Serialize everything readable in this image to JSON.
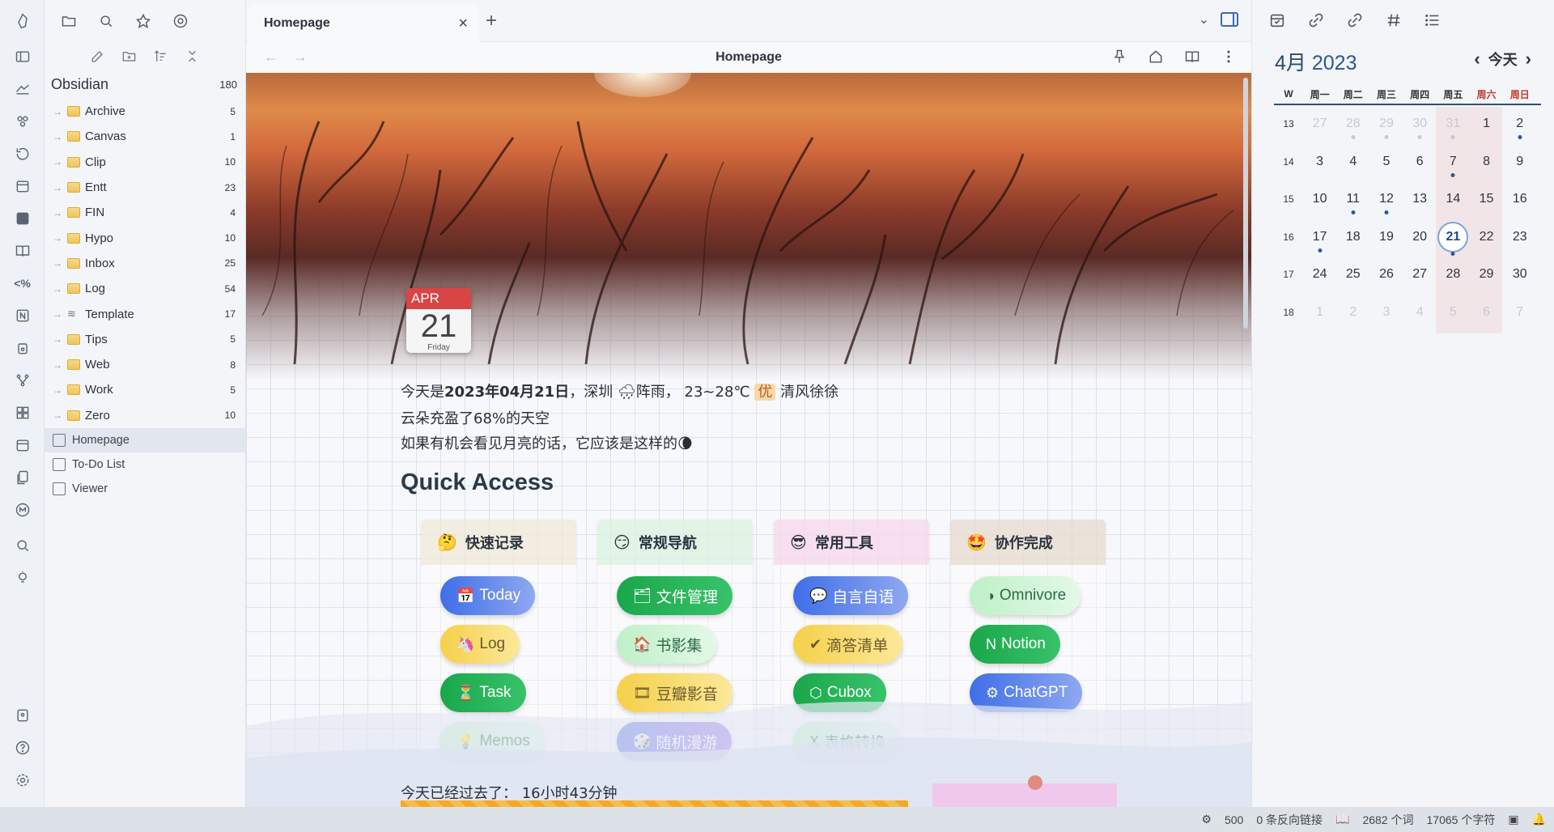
{
  "ribbon": {
    "icons": [
      "obsidian-logo-icon",
      "layout-icon",
      "flashcards-icon",
      "graph-icon",
      "history-icon",
      "calendar-icon",
      "hub-icon",
      "book-icon",
      "template-icon",
      "notion-icon",
      "copy-icon",
      "git-icon",
      "grid-icon",
      "calendar-icon-2",
      "files-icon",
      "medium-icon",
      "search-icon",
      "bulb-icon",
      "vault-icon",
      "help-icon",
      "settings-icon"
    ]
  },
  "sidebar": {
    "vault_name": "Obsidian",
    "vault_count": "180",
    "folders": [
      {
        "label": "Archive",
        "count": "5"
      },
      {
        "label": "Canvas",
        "count": "1"
      },
      {
        "label": "Clip",
        "count": "10"
      },
      {
        "label": "Entt",
        "count": "23"
      },
      {
        "label": "FIN",
        "count": "4"
      },
      {
        "label": "Hypo",
        "count": "10"
      },
      {
        "label": "Inbox",
        "count": "25"
      },
      {
        "label": "Log",
        "count": "54"
      },
      {
        "label": "Template",
        "count": "17"
      },
      {
        "label": "Tips",
        "count": "5"
      },
      {
        "label": "Web",
        "count": "8"
      },
      {
        "label": "Work",
        "count": "5"
      },
      {
        "label": "Zero",
        "count": "10"
      }
    ],
    "notes": [
      "Homepage",
      "To-Do List",
      "Viewer"
    ]
  },
  "tab": {
    "label": "Homepage"
  },
  "view": {
    "title": "Homepage"
  },
  "calendar_icon": {
    "month": "APR",
    "day": "21",
    "weekday": "Friday"
  },
  "weather": {
    "line1_pre": "今天是",
    "line1_date": "2023年04月21日",
    "line1_city": "，深圳 ",
    "line1_icon": "🌧",
    "line1_weather": "阵雨，  23~28℃ ",
    "line1_aqi": "优",
    "line1_wind": " 清风徐徐",
    "line2": "云朵充盈了68%的天空",
    "line3": "如果有机会看见月亮的话，它应该是这样的",
    "moon": "🌘"
  },
  "quick_access": {
    "title": "Quick Access"
  },
  "cards": [
    {
      "title": "快速记录",
      "emoji": "🤔",
      "bg": "rgba(235,225,200,.55)",
      "pills": [
        {
          "label": "Today",
          "icon": "📅",
          "style": "blue"
        },
        {
          "label": "Log",
          "icon": "🦄",
          "style": "yellow"
        },
        {
          "label": "Task",
          "icon": "⏳",
          "style": "green"
        },
        {
          "label": "Memos",
          "icon": "💡",
          "style": "mint"
        }
      ]
    },
    {
      "title": "常规导航",
      "emoji": "😏",
      "bg": "rgba(210,240,215,.6)",
      "pills": [
        {
          "label": "文件管理",
          "icon": "🗂",
          "style": "green"
        },
        {
          "label": "书影集",
          "icon": "🏠",
          "style": "mint"
        },
        {
          "label": "豆瓣影音",
          "icon": "🎞",
          "style": "yellow"
        },
        {
          "label": "随机漫游",
          "icon": "🎲",
          "style": "purple"
        }
      ]
    },
    {
      "title": "常用工具",
      "emoji": "😎",
      "bg": "rgba(245,200,230,.55)",
      "pills": [
        {
          "label": "自言自语",
          "icon": "💬",
          "style": "blue"
        },
        {
          "label": "滴答清单",
          "icon": "✔",
          "style": "yellow"
        },
        {
          "label": "Cubox",
          "icon": "⬡",
          "style": "green"
        },
        {
          "label": "表格转换",
          "icon": "X",
          "style": "mint"
        }
      ]
    },
    {
      "title": "协作完成",
      "emoji": "🤩",
      "bg": "rgba(225,210,195,.6)",
      "pills": [
        {
          "label": "Omnivore",
          "icon": "◑",
          "style": "mint"
        },
        {
          "label": "Notion",
          "icon": "N",
          "style": "green"
        },
        {
          "label": "ChatGPT",
          "icon": "⚙",
          "style": "blue"
        }
      ]
    }
  ],
  "elapsed": "今天已经过去了：  16小时43分钟",
  "calendar": {
    "month": "4月",
    "year": "2023",
    "today_label": "今天",
    "weekdays": [
      "W",
      "周一",
      "周二",
      "周三",
      "周四",
      "周五",
      "周六",
      "周日"
    ],
    "rows": [
      {
        "w": "13",
        "days": [
          "27",
          "28",
          "29",
          "30",
          "31",
          "1",
          "2"
        ]
      },
      {
        "w": "14",
        "days": [
          "3",
          "4",
          "5",
          "6",
          "7",
          "8",
          "9"
        ]
      },
      {
        "w": "15",
        "days": [
          "10",
          "11",
          "12",
          "13",
          "14",
          "15",
          "16"
        ]
      },
      {
        "w": "16",
        "days": [
          "17",
          "18",
          "19",
          "20",
          "21",
          "22",
          "23"
        ]
      },
      {
        "w": "17",
        "days": [
          "24",
          "25",
          "26",
          "27",
          "28",
          "29",
          "30"
        ]
      },
      {
        "w": "18",
        "days": [
          "1",
          "2",
          "3",
          "4",
          "5",
          "6",
          "7"
        ]
      }
    ]
  },
  "status": {
    "count": "500",
    "backlinks": "0 条反向链接",
    "words": "2682 个词",
    "chars": "17065 个字符"
  }
}
